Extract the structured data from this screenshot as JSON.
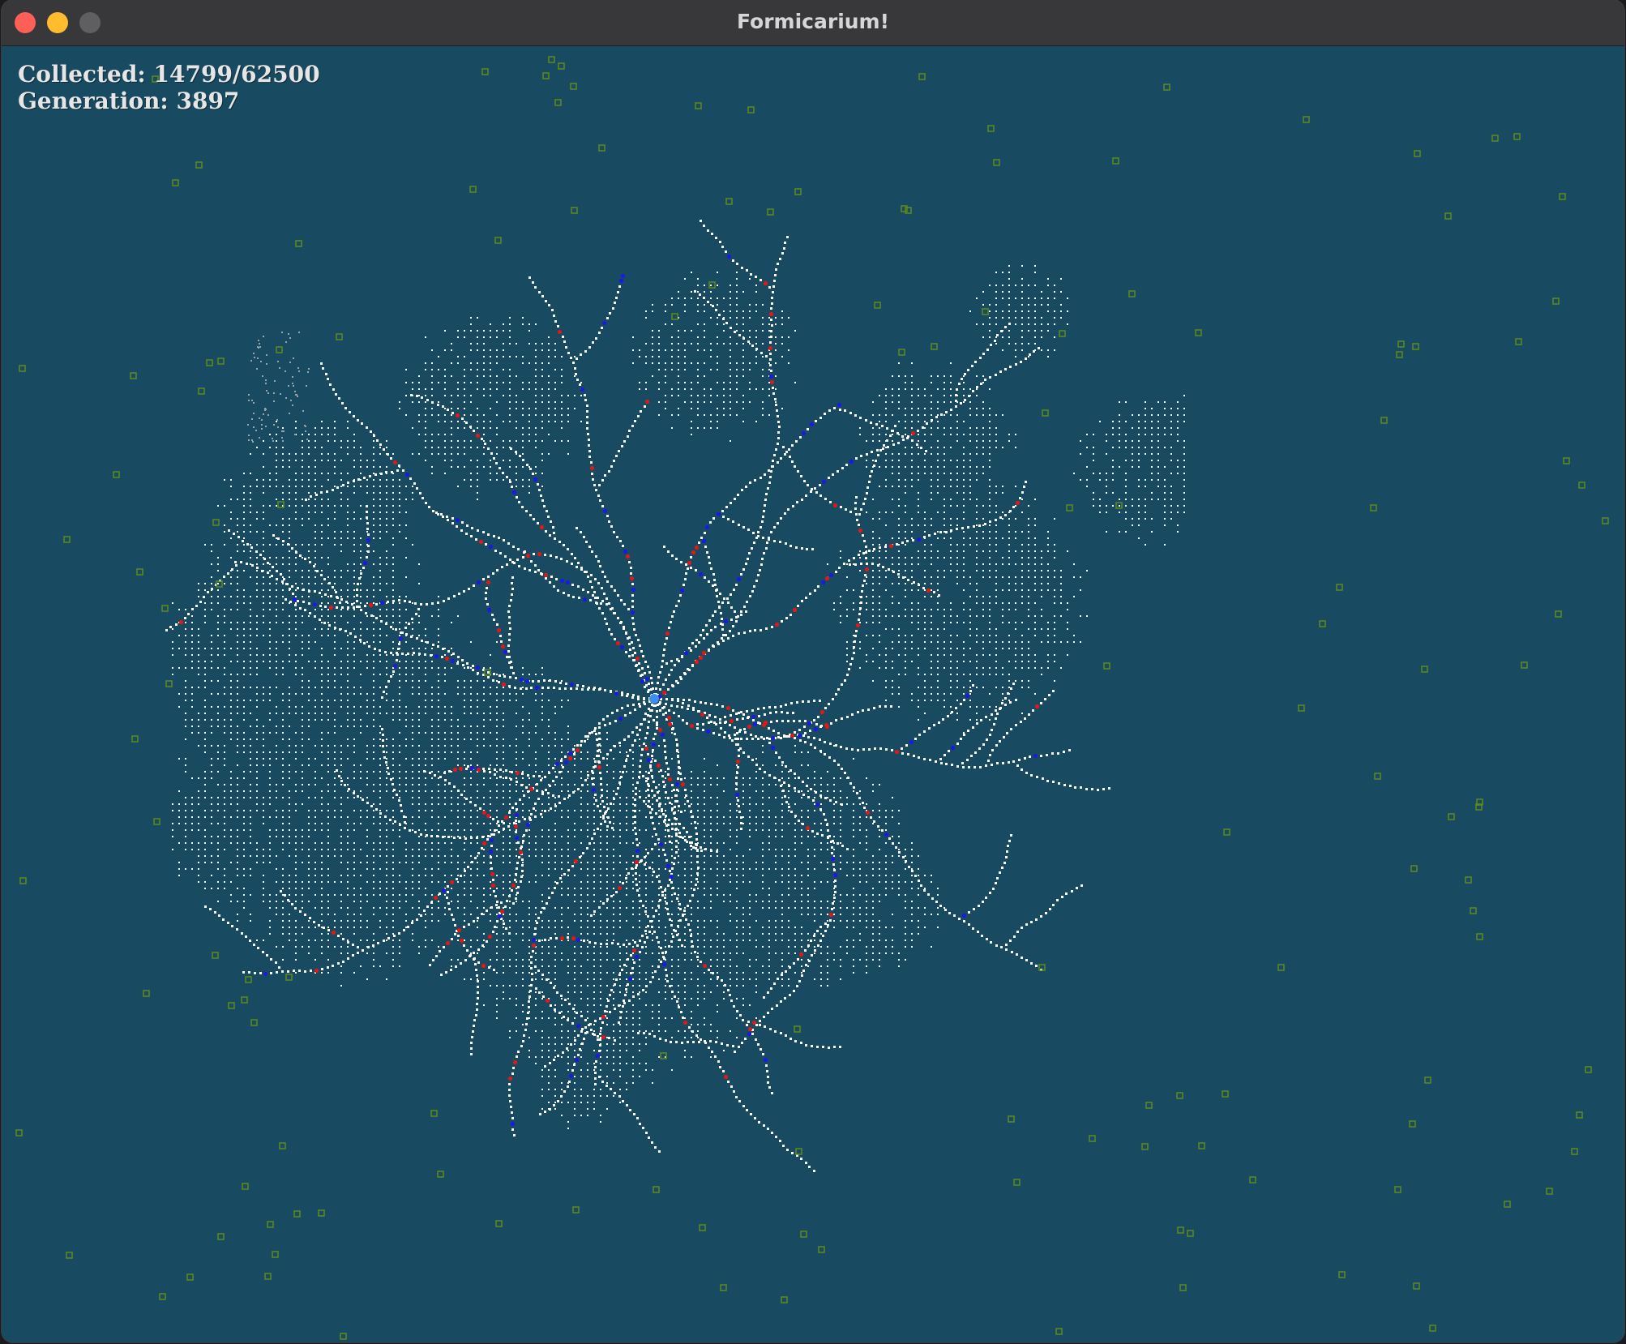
{
  "window": {
    "title": "Formicarium!"
  },
  "hud": {
    "collected_label": "Collected:",
    "collected_value": "14799/62500",
    "generation_label": "Generation:",
    "generation_value": "3897"
  },
  "colors": {
    "background": "#184b61",
    "trail": "#ffffff",
    "faded_trail": "#9aa3a8",
    "ant_blue": "#1a1ae6",
    "ant_red": "#e01818",
    "food": "#5f8a1c",
    "nest": "#3e8ef0"
  }
}
